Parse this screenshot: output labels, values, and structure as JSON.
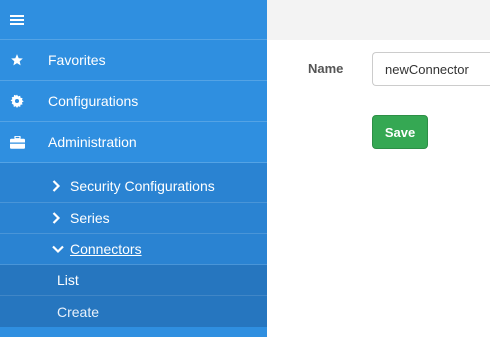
{
  "sidebar": {
    "toggle_icon": "hamburger-icon",
    "main_items": [
      {
        "label": "Favorites",
        "icon": "star-icon"
      },
      {
        "label": "Configurations",
        "icon": "gear-icon"
      },
      {
        "label": "Administration",
        "icon": "briefcase-icon"
      }
    ],
    "admin_items": [
      {
        "label": "Security Configurations",
        "icon": "chevron-right-icon"
      },
      {
        "label": "Series",
        "icon": "chevron-right-icon"
      },
      {
        "label": "Connectors",
        "icon": "chevron-down-icon"
      }
    ],
    "connector_items": [
      {
        "label": "List"
      },
      {
        "label": "Create"
      }
    ]
  },
  "form": {
    "name_label": "Name",
    "name_value": "newConnector",
    "save_label": "Save"
  },
  "colors": {
    "sidebar_bg": "#2f8fe0",
    "submenu_bg": "#2a83d2",
    "subsubmenu_bg": "#2676bf",
    "save_button": "#35a853"
  }
}
